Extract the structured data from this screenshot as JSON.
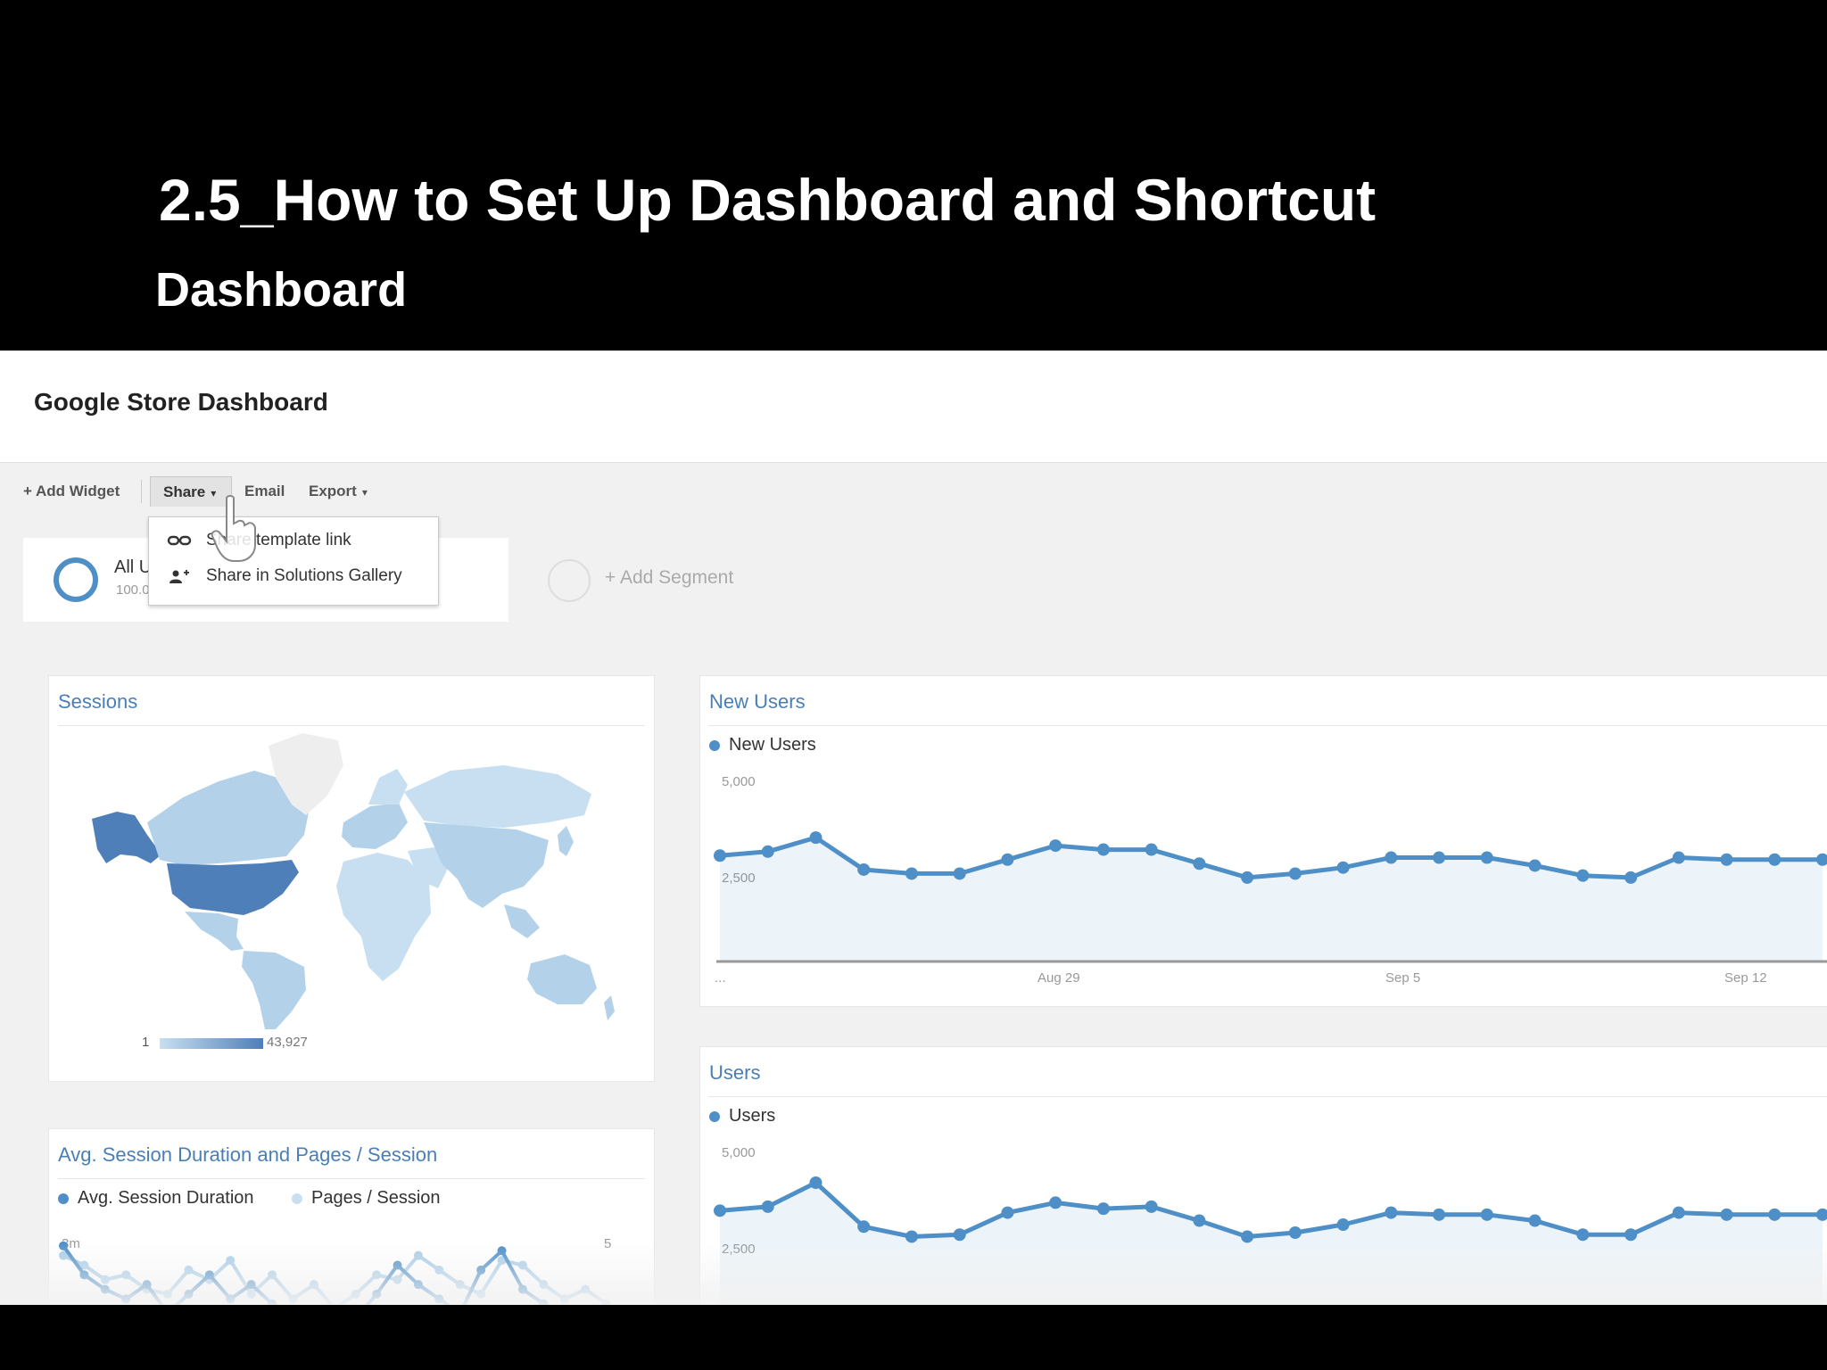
{
  "slide": {
    "title": "2.5_How to Set Up Dashboard and Shortcut",
    "subtitle": "Dashboard"
  },
  "dashboard": {
    "title": "Google Store Dashboard",
    "toolbar": {
      "add_widget": "+ Add Widget",
      "share": "Share",
      "email": "Email",
      "export": "Export"
    },
    "share_menu": [
      {
        "label": "Share template link",
        "icon": "link-icon"
      },
      {
        "label": "Share in Solutions Gallery",
        "icon": "add-person-icon"
      }
    ],
    "segment": {
      "name": "All Users",
      "pct": "100.00%"
    },
    "add_segment": "+ Add Segment",
    "colors": {
      "accent": "#4f8fc7",
      "title": "#4a7fb5",
      "highlight": "#4f7fb8"
    },
    "widgets": {
      "sessions": {
        "title": "Sessions",
        "scale_min": "1",
        "scale_max": "43,927"
      },
      "avg": {
        "title": "Avg. Session Duration and Pages / Session",
        "legend": [
          "Avg. Session Duration",
          "Pages / Session"
        ],
        "y_left": "3m",
        "y_right": "5"
      },
      "new_users": {
        "title": "New Users",
        "legend": "New Users",
        "y_top": "5,000",
        "y_mid": "2,500",
        "x_first": "...",
        "x_labels": [
          "Aug 29",
          "Sep 5",
          "Sep 12"
        ]
      },
      "users": {
        "title": "Users",
        "legend": "Users",
        "y_top": "5,000",
        "y_mid": "2,500"
      }
    }
  },
  "chart_data": [
    {
      "type": "area",
      "title": "New Users",
      "x": [
        "...",
        "",
        "",
        "",
        "",
        "",
        "",
        "Aug 29",
        "",
        "",
        "",
        "",
        "",
        "",
        "Sep 5",
        "",
        "",
        "",
        "",
        "",
        "",
        "Sep 12",
        "",
        ""
      ],
      "series": [
        {
          "name": "New Users",
          "values": [
            2650,
            2750,
            3100,
            2300,
            2200,
            2200,
            2550,
            2900,
            2800,
            2800,
            2450,
            2100,
            2200,
            2350,
            2600,
            2600,
            2600,
            2400,
            2150,
            2100,
            2600,
            2550,
            2550,
            2550
          ]
        }
      ],
      "ylim": [
        0,
        5000
      ]
    },
    {
      "type": "area",
      "title": "Users",
      "series": [
        {
          "name": "Users",
          "values": [
            3050,
            3150,
            3750,
            2650,
            2400,
            2450,
            3000,
            3250,
            3100,
            3150,
            2800,
            2400,
            2500,
            2700,
            3000,
            2950,
            2950,
            2800,
            2450,
            2450,
            3000,
            2950,
            2950,
            2950
          ]
        }
      ],
      "ylim": [
        0,
        5000
      ]
    },
    {
      "type": "line",
      "title": "Avg. Session Duration and Pages / Session",
      "series": [
        {
          "name": "Avg. Session Duration",
          "values": [
            3.0,
            2.4,
            2.1,
            1.9,
            2.2,
            1.6,
            2.0,
            2.4,
            1.9,
            2.2,
            1.8,
            1.4,
            1.6,
            1.2,
            1.5,
            2.0,
            2.6,
            2.2,
            1.9,
            1.6,
            2.5,
            2.9,
            2.1,
            1.8,
            1.4,
            1.6,
            1.2,
            1.1
          ]
        },
        {
          "name": "Pages / Session",
          "values": [
            2.8,
            2.6,
            2.3,
            2.4,
            2.1,
            2.0,
            2.5,
            2.3,
            2.7,
            2.0,
            2.4,
            1.9,
            2.2,
            1.7,
            2.0,
            2.4,
            2.3,
            2.8,
            2.5,
            2.2,
            2.0,
            2.7,
            2.6,
            2.2,
            1.9,
            2.1,
            1.8,
            1.5
          ]
        }
      ]
    }
  ]
}
